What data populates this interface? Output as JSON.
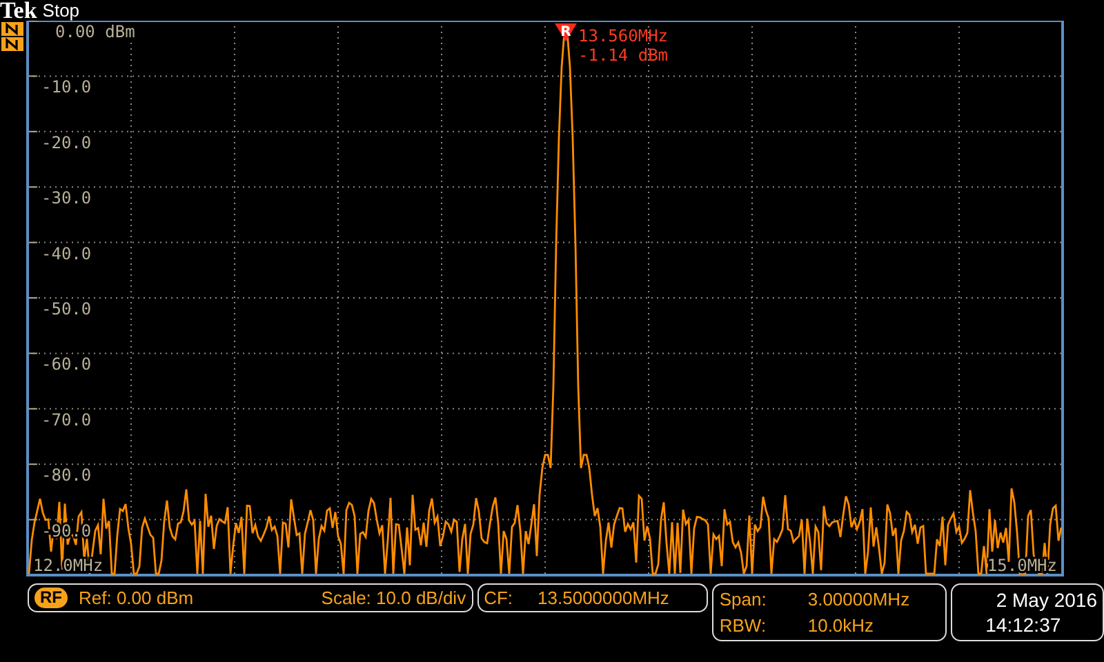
{
  "header": {
    "brand": "Tek",
    "status": "Stop"
  },
  "plot": {
    "y_labels": [
      "0.00 dBm",
      "-10.0",
      "-20.0",
      "-30.0",
      "-40.0",
      "-50.0",
      "-60.0",
      "-70.0",
      "-80.0",
      "-90.0"
    ],
    "x_labels": [
      "12.0MHz",
      "15.0MHz"
    ],
    "marker": {
      "label": "R",
      "frequency": "13.560MHz",
      "reading": "-1.14 dBm"
    }
  },
  "bottom_bar": {
    "source_badge": "RF",
    "ref": "Ref: 0.00 dBm",
    "scale": "Scale: 10.0 dB/div",
    "cf_label": "CF:",
    "cf_value": "13.5000000MHz",
    "span_label": "Span:",
    "span_value": "3.00000MHz",
    "rbw_label": "RBW:",
    "rbw_value": "10.0kHz",
    "date": "2 May 2016",
    "time": "14:12:37"
  }
}
